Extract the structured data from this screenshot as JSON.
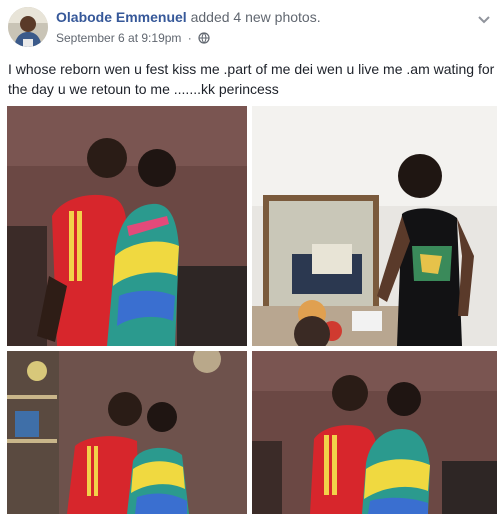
{
  "post": {
    "author": "Olabode Emmenuel",
    "action": "added 4 new photos.",
    "timestamp": "September 6 at 9:19pm",
    "separator": "·",
    "privacy_icon": "globe-icon",
    "menu_icon": "chevron-down-icon",
    "text": "I whose reborn wen u fest kiss me .part of me dei wen u live me .am wating for the day u we retoun to me .......kk perincess"
  },
  "photos": [
    {
      "name": "photo-1",
      "subject": "couple-kissing"
    },
    {
      "name": "photo-2",
      "subject": "man-standing"
    },
    {
      "name": "photo-3",
      "subject": "couple-posing"
    },
    {
      "name": "photo-4",
      "subject": "couple-kissing"
    }
  ],
  "colors": {
    "link": "#365899",
    "meta": "#616770",
    "text": "#1d2129"
  }
}
